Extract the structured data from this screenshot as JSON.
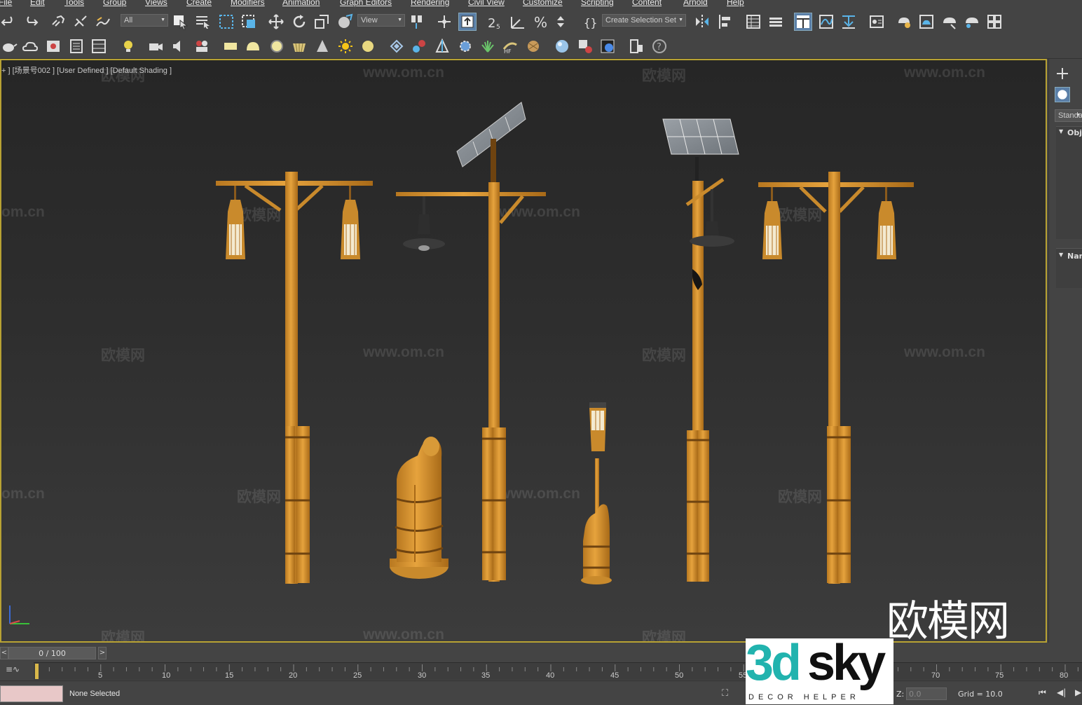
{
  "menubar": {
    "items": [
      "File",
      "Edit",
      "Tools",
      "Group",
      "Views",
      "Create",
      "Modifiers",
      "Animation",
      "Graph Editors",
      "Rendering",
      "Civil View",
      "Customize",
      "Scripting",
      "Content",
      "Arnold",
      "Help"
    ]
  },
  "toolbar": {
    "selection_filter": "All",
    "reference_coord": "View",
    "selection_set": "Create Selection Set"
  },
  "viewport": {
    "label": "+ ] [场景号002 ] [User Defined ] [Default Shading ]",
    "watermark_site": "www.om.cn",
    "watermark_site_partial": "om.cn",
    "watermark_brand": "欧模网"
  },
  "command_panel": {
    "dropdown": "Standa",
    "rollout_object": "Obj",
    "rollout_name": "Nan"
  },
  "timeline": {
    "frame": "0 / 100",
    "prev_arrow": "<",
    "next_arrow": ">",
    "ticks": [
      "5",
      "10",
      "15",
      "20",
      "25",
      "30",
      "35",
      "40",
      "45",
      "50",
      "55",
      "70",
      "75",
      "80"
    ]
  },
  "status": {
    "selection": "None Selected",
    "z_label": "Z:",
    "z_value": "0.0",
    "grid": "Grid = 10.0"
  },
  "branding": {
    "site_logo": "欧模网",
    "brand_3d": "3d",
    "brand_sky": "sky",
    "brand_tagline": "DECOR HELPER"
  },
  "colors": {
    "bamboo": "#d4912f",
    "viewport_border": "#b8a233",
    "active_button": "#5a7fa8",
    "brand_teal": "#21b3ae"
  }
}
